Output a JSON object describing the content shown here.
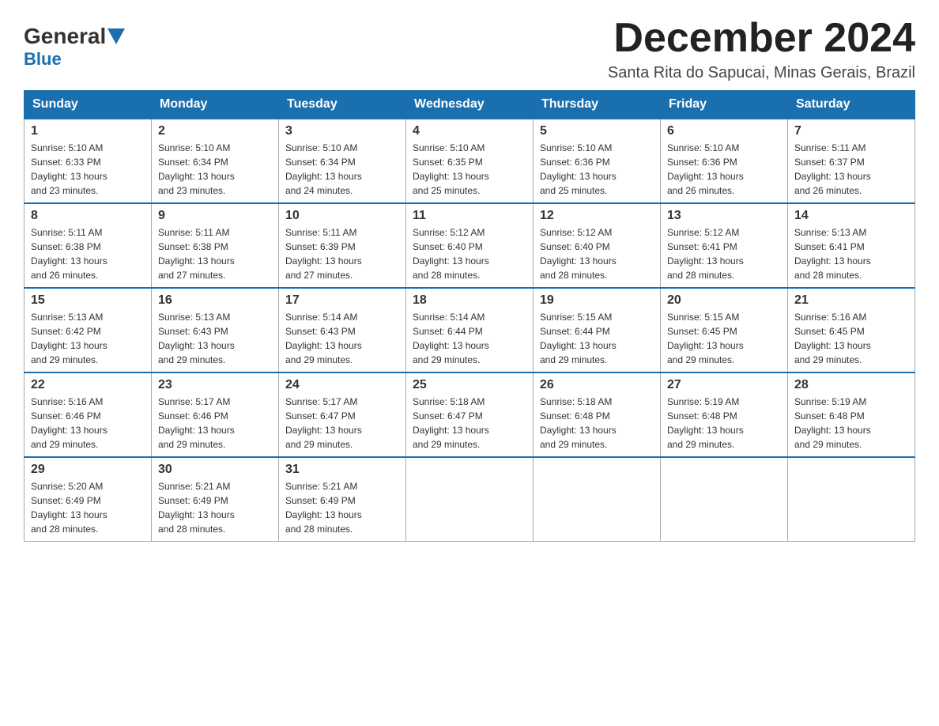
{
  "header": {
    "logo_general": "General",
    "logo_blue": "Blue",
    "title": "December 2024",
    "location": "Santa Rita do Sapucai, Minas Gerais, Brazil"
  },
  "days_of_week": [
    "Sunday",
    "Monday",
    "Tuesday",
    "Wednesday",
    "Thursday",
    "Friday",
    "Saturday"
  ],
  "weeks": [
    [
      {
        "day": "1",
        "sunrise": "5:10 AM",
        "sunset": "6:33 PM",
        "daylight": "13 hours and 23 minutes."
      },
      {
        "day": "2",
        "sunrise": "5:10 AM",
        "sunset": "6:34 PM",
        "daylight": "13 hours and 23 minutes."
      },
      {
        "day": "3",
        "sunrise": "5:10 AM",
        "sunset": "6:34 PM",
        "daylight": "13 hours and 24 minutes."
      },
      {
        "day": "4",
        "sunrise": "5:10 AM",
        "sunset": "6:35 PM",
        "daylight": "13 hours and 25 minutes."
      },
      {
        "day": "5",
        "sunrise": "5:10 AM",
        "sunset": "6:36 PM",
        "daylight": "13 hours and 25 minutes."
      },
      {
        "day": "6",
        "sunrise": "5:10 AM",
        "sunset": "6:36 PM",
        "daylight": "13 hours and 26 minutes."
      },
      {
        "day": "7",
        "sunrise": "5:11 AM",
        "sunset": "6:37 PM",
        "daylight": "13 hours and 26 minutes."
      }
    ],
    [
      {
        "day": "8",
        "sunrise": "5:11 AM",
        "sunset": "6:38 PM",
        "daylight": "13 hours and 26 minutes."
      },
      {
        "day": "9",
        "sunrise": "5:11 AM",
        "sunset": "6:38 PM",
        "daylight": "13 hours and 27 minutes."
      },
      {
        "day": "10",
        "sunrise": "5:11 AM",
        "sunset": "6:39 PM",
        "daylight": "13 hours and 27 minutes."
      },
      {
        "day": "11",
        "sunrise": "5:12 AM",
        "sunset": "6:40 PM",
        "daylight": "13 hours and 28 minutes."
      },
      {
        "day": "12",
        "sunrise": "5:12 AM",
        "sunset": "6:40 PM",
        "daylight": "13 hours and 28 minutes."
      },
      {
        "day": "13",
        "sunrise": "5:12 AM",
        "sunset": "6:41 PM",
        "daylight": "13 hours and 28 minutes."
      },
      {
        "day": "14",
        "sunrise": "5:13 AM",
        "sunset": "6:41 PM",
        "daylight": "13 hours and 28 minutes."
      }
    ],
    [
      {
        "day": "15",
        "sunrise": "5:13 AM",
        "sunset": "6:42 PM",
        "daylight": "13 hours and 29 minutes."
      },
      {
        "day": "16",
        "sunrise": "5:13 AM",
        "sunset": "6:43 PM",
        "daylight": "13 hours and 29 minutes."
      },
      {
        "day": "17",
        "sunrise": "5:14 AM",
        "sunset": "6:43 PM",
        "daylight": "13 hours and 29 minutes."
      },
      {
        "day": "18",
        "sunrise": "5:14 AM",
        "sunset": "6:44 PM",
        "daylight": "13 hours and 29 minutes."
      },
      {
        "day": "19",
        "sunrise": "5:15 AM",
        "sunset": "6:44 PM",
        "daylight": "13 hours and 29 minutes."
      },
      {
        "day": "20",
        "sunrise": "5:15 AM",
        "sunset": "6:45 PM",
        "daylight": "13 hours and 29 minutes."
      },
      {
        "day": "21",
        "sunrise": "5:16 AM",
        "sunset": "6:45 PM",
        "daylight": "13 hours and 29 minutes."
      }
    ],
    [
      {
        "day": "22",
        "sunrise": "5:16 AM",
        "sunset": "6:46 PM",
        "daylight": "13 hours and 29 minutes."
      },
      {
        "day": "23",
        "sunrise": "5:17 AM",
        "sunset": "6:46 PM",
        "daylight": "13 hours and 29 minutes."
      },
      {
        "day": "24",
        "sunrise": "5:17 AM",
        "sunset": "6:47 PM",
        "daylight": "13 hours and 29 minutes."
      },
      {
        "day": "25",
        "sunrise": "5:18 AM",
        "sunset": "6:47 PM",
        "daylight": "13 hours and 29 minutes."
      },
      {
        "day": "26",
        "sunrise": "5:18 AM",
        "sunset": "6:48 PM",
        "daylight": "13 hours and 29 minutes."
      },
      {
        "day": "27",
        "sunrise": "5:19 AM",
        "sunset": "6:48 PM",
        "daylight": "13 hours and 29 minutes."
      },
      {
        "day": "28",
        "sunrise": "5:19 AM",
        "sunset": "6:48 PM",
        "daylight": "13 hours and 29 minutes."
      }
    ],
    [
      {
        "day": "29",
        "sunrise": "5:20 AM",
        "sunset": "6:49 PM",
        "daylight": "13 hours and 28 minutes."
      },
      {
        "day": "30",
        "sunrise": "5:21 AM",
        "sunset": "6:49 PM",
        "daylight": "13 hours and 28 minutes."
      },
      {
        "day": "31",
        "sunrise": "5:21 AM",
        "sunset": "6:49 PM",
        "daylight": "13 hours and 28 minutes."
      },
      null,
      null,
      null,
      null
    ]
  ],
  "labels": {
    "sunrise": "Sunrise:",
    "sunset": "Sunset:",
    "daylight": "Daylight:"
  }
}
